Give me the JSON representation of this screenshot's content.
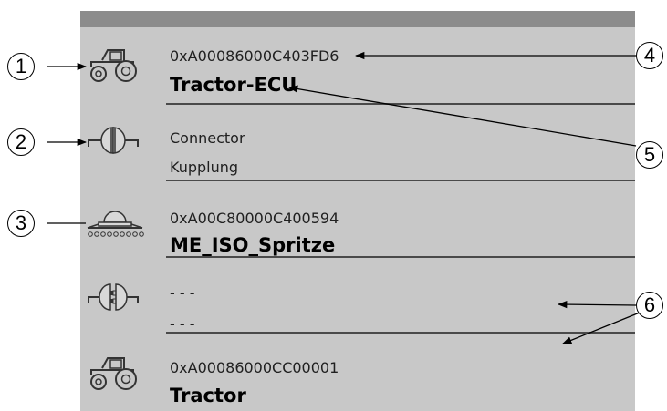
{
  "rows": [
    {
      "icon": "tractor-icon",
      "line1": "0xA00086000C403FD6",
      "line2": "Tractor-ECU"
    },
    {
      "icon": "connector-icon",
      "line1": "Connector",
      "line2": "Kupplung"
    },
    {
      "icon": "sprayer-icon",
      "line1": "0xA00C80000C400594",
      "line2": "ME_ISO_Spritze"
    },
    {
      "icon": "disconnected-connector-icon",
      "line1": "- - -",
      "line2": "- - -"
    },
    {
      "icon": "tractor-icon",
      "line1": "0xA00086000CC00001",
      "line2": "Tractor"
    }
  ],
  "callouts": [
    "1",
    "2",
    "3",
    "4",
    "5",
    "6"
  ],
  "colors": {
    "panel": "#c8c8c8",
    "header": "#8c8c8c",
    "separator": "#4a4a4a"
  }
}
